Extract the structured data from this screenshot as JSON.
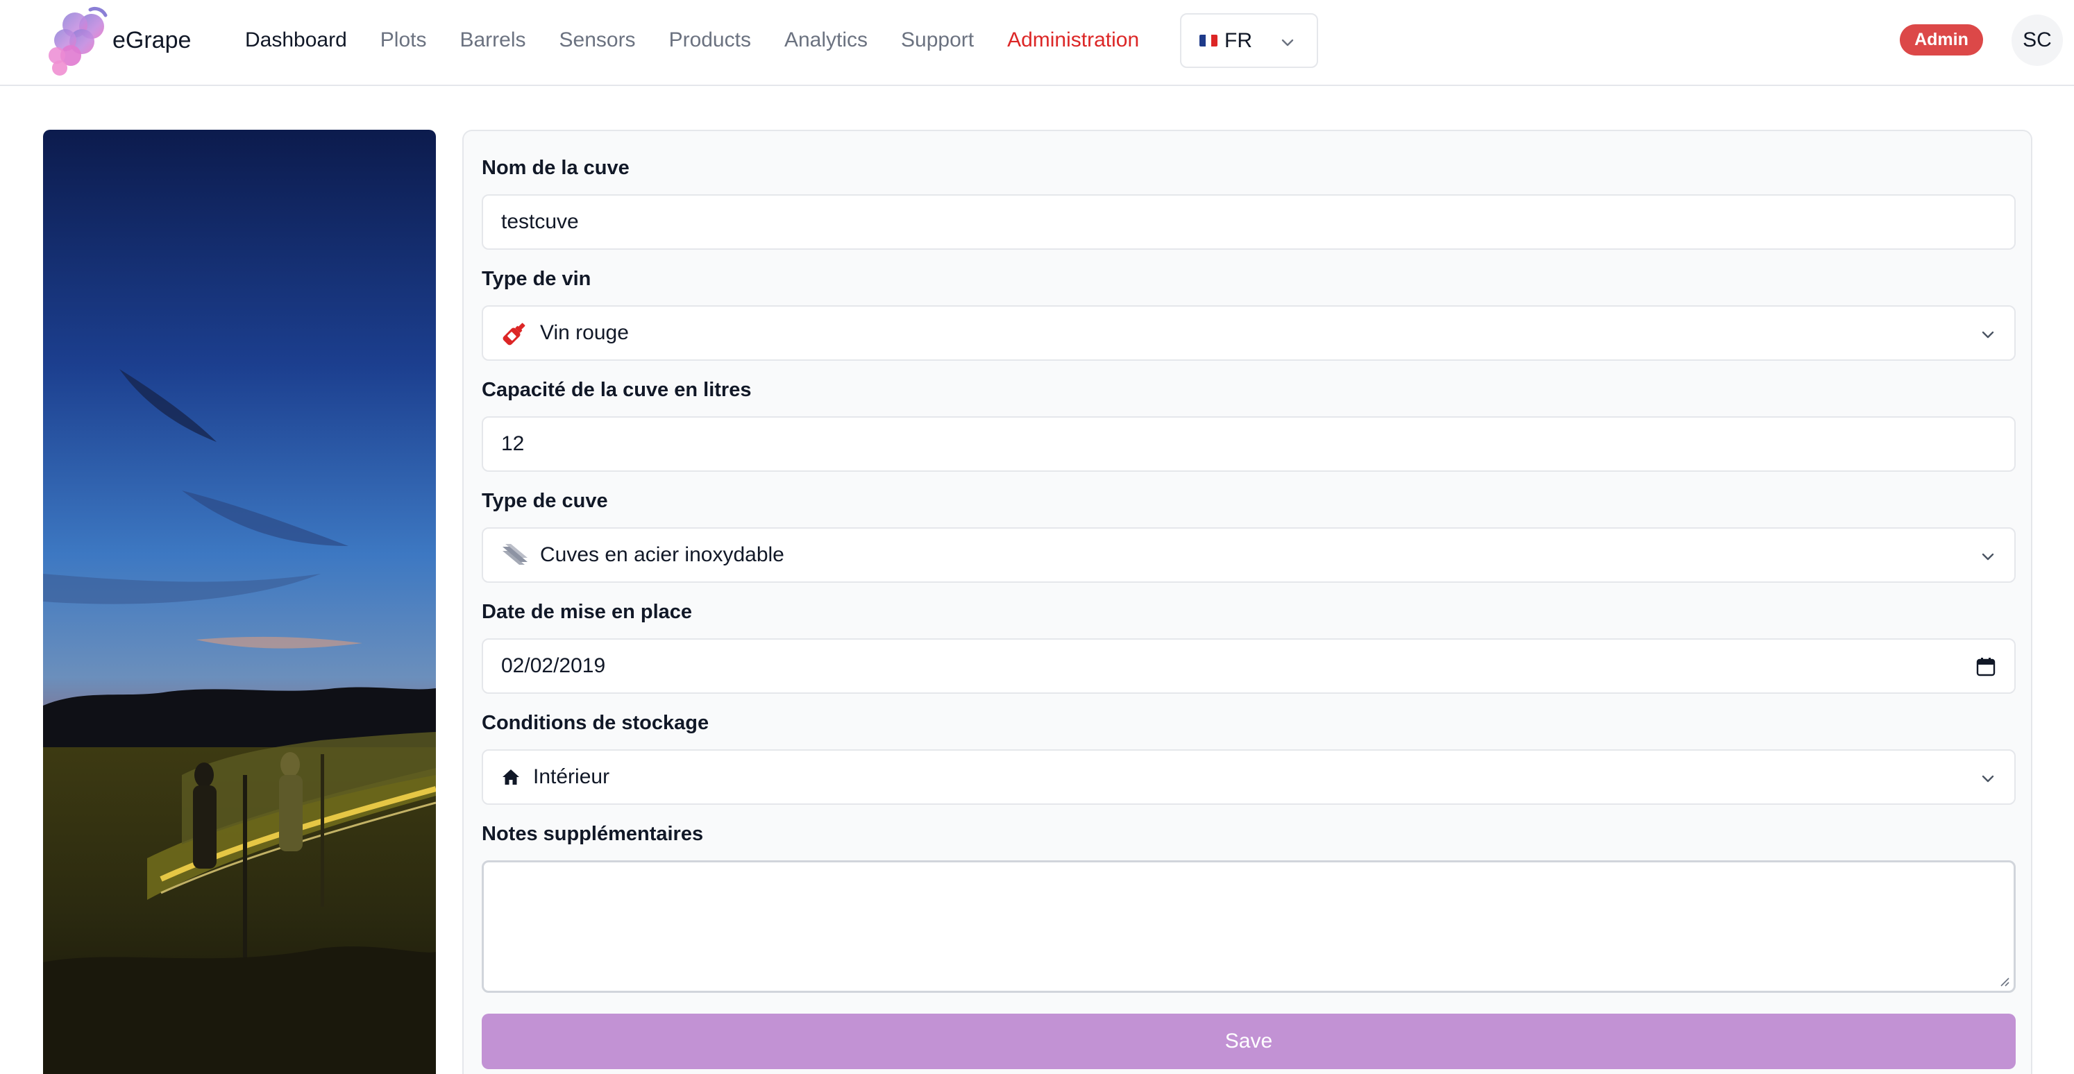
{
  "app": {
    "brand": "eGrape"
  },
  "nav": {
    "items": [
      {
        "label": "Dashboard",
        "state": "active"
      },
      {
        "label": "Plots",
        "state": "normal"
      },
      {
        "label": "Barrels",
        "state": "normal"
      },
      {
        "label": "Sensors",
        "state": "normal"
      },
      {
        "label": "Products",
        "state": "normal"
      },
      {
        "label": "Analytics",
        "state": "normal"
      },
      {
        "label": "Support",
        "state": "normal"
      },
      {
        "label": "Administration",
        "state": "admin"
      }
    ]
  },
  "language": {
    "code": "FR",
    "icon": "france-flag-icon"
  },
  "user": {
    "role_badge": "Admin",
    "initials": "SC"
  },
  "form": {
    "tank_name": {
      "label": "Nom de la cuve",
      "value": "testcuve"
    },
    "wine_type": {
      "label": "Type de vin",
      "value": "Vin rouge",
      "icon": "wine-bottle-icon"
    },
    "capacity": {
      "label": "Capacité de la cuve en litres",
      "value": "12"
    },
    "tank_type": {
      "label": "Type de cuve",
      "value": "Cuves en acier inoxydable",
      "icon": "steel-tank-icon"
    },
    "install_date": {
      "label": "Date de mise en place",
      "value": "02/02/2019",
      "icon": "calendar-icon"
    },
    "storage": {
      "label": "Conditions de stockage",
      "value": "Intérieur",
      "icon": "house-icon"
    },
    "notes": {
      "label": "Notes supplémentaires",
      "value": ""
    },
    "save_label": "Save"
  },
  "colors": {
    "admin_link": "#dc2626",
    "admin_badge": "#dc4848",
    "save_button": "#c292d4",
    "wine_icon": "#dc2626"
  }
}
